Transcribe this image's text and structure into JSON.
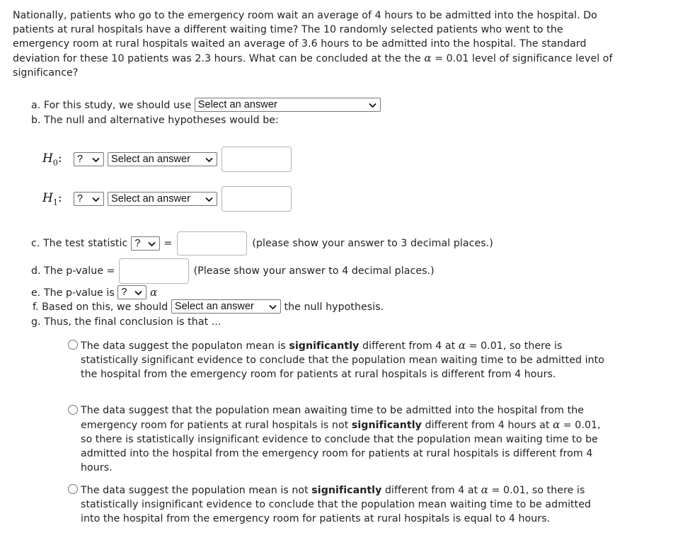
{
  "question": {
    "intro": "Nationally, patients who go to the emergency room wait an average of 4 hours to be admitted into the hospital. Do patients at rural hospitals have a different waiting time? The 10 randomly selected patients who went to the emergency room at rural hospitals waited an average of 3.6 hours to be admitted into the hospital. The standard deviation for these 10 patients was 2.3 hours. What can be concluded at the the",
    "intro_alpha": "α",
    "intro_tail": "= 0.01 level of significance level of significance?"
  },
  "part_a": {
    "label": "a. For this study, we should use",
    "select_value": "Select an answer"
  },
  "part_b": {
    "label": "b. The null and alternative hypotheses would be:",
    "h0": {
      "symbol": "H",
      "sub": "0",
      "colon": ":",
      "sign_value": "?",
      "param_value": "Select an answer",
      "input_value": ""
    },
    "h1": {
      "symbol": "H",
      "sub": "1",
      "colon": ":",
      "sign_value": "?",
      "param_value": "Select an answer",
      "input_value": ""
    }
  },
  "part_c": {
    "label": "c. The test statistic",
    "select_value": "?",
    "equals": "=",
    "input_value": "",
    "hint": "(please show your answer to 3 decimal places.)"
  },
  "part_d": {
    "label": "d. The p-value =",
    "input_value": "",
    "hint": "(Please show your answer to 4 decimal places.)"
  },
  "part_e": {
    "label": "e. The p-value is",
    "select_value": "?",
    "alpha": "α"
  },
  "part_f": {
    "label": "f. Based on this, we should",
    "select_value": "Select an answer",
    "tail": "the null hypothesis."
  },
  "part_g": {
    "label": "g. Thus, the final conclusion is that ...",
    "options": [
      {
        "selected": false,
        "pre": "The data suggest the populaton mean is",
        "bold": "significantly",
        "mid": "different from 4 at",
        "alpha": "α",
        "post": "= 0.01, so there is statistically significant evidence to conclude that the population mean waiting time to be admitted into the hospital from the emergency room for patients at rural hospitals is different from 4 hours."
      },
      {
        "selected": false,
        "pre": "The data suggest that the population mean awaiting time to be admitted into the hospital from the emergency room for patients at rural hospitals is not",
        "bold": "significantly",
        "mid": "different from 4 hours at",
        "alpha": "α",
        "post": "= 0.01, so there is statistically insignificant evidence to conclude that the population mean waiting time to be admitted into the hospital from the emergency room for patients at rural hospitals is different from 4 hours."
      },
      {
        "selected": false,
        "pre": "The data suggest the population mean is not",
        "bold": "significantly",
        "mid": "different from 4 at",
        "alpha": "α",
        "post": "= 0.01, so there is statistically insignificant evidence to conclude that the population mean waiting time to be admitted into the hospital from the emergency room for patients at rural hospitals is equal to 4 hours."
      }
    ]
  }
}
